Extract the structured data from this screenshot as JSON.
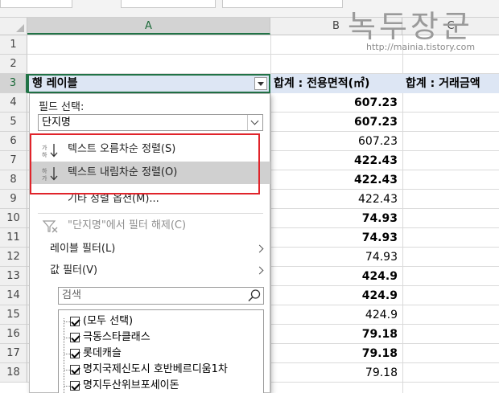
{
  "columns": [
    "A",
    "B",
    "C"
  ],
  "rows": [
    "1",
    "2",
    "3",
    "4",
    "5",
    "6",
    "7",
    "8",
    "9",
    "10",
    "11",
    "12",
    "13",
    "14",
    "15",
    "16",
    "17",
    "18"
  ],
  "header_row": {
    "row_label": "행 레이블",
    "area_sum": "합계 : 전용면적(㎡)",
    "price_sum": "합계 : 거래금액"
  },
  "b_values": [
    {
      "v": "607.23",
      "bold": true
    },
    {
      "v": "607.23",
      "bold": true
    },
    {
      "v": "607.23",
      "bold": false
    },
    {
      "v": "422.43",
      "bold": true
    },
    {
      "v": "422.43",
      "bold": true
    },
    {
      "v": "422.43",
      "bold": false
    },
    {
      "v": "74.93",
      "bold": true
    },
    {
      "v": "74.93",
      "bold": true
    },
    {
      "v": "74.93",
      "bold": false
    },
    {
      "v": "424.9",
      "bold": true
    },
    {
      "v": "424.9",
      "bold": true
    },
    {
      "v": "424.9",
      "bold": false
    },
    {
      "v": "79.18",
      "bold": true
    },
    {
      "v": "79.18",
      "bold": true
    },
    {
      "v": "79.18",
      "bold": false
    }
  ],
  "watermark": {
    "title": "녹두장군",
    "url": "http://mainia.tistory.com"
  },
  "panel": {
    "field_label": "필드 선택:",
    "field_value": "단지명",
    "sort_asc": "텍스트 오름차순 정렬(S)",
    "sort_desc": "텍스트 내림차순 정렬(O)",
    "more_sort": "기타 정렬 옵션(M)...",
    "clear_filter": "\"단지명\"에서 필터 해제(C)",
    "label_filter": "레이블 필터(L)",
    "value_filter": "값 필터(V)",
    "search_placeholder": "검색",
    "list": [
      "(모두 선택)",
      "극동스타클래스",
      "롯데캐슬",
      "명지국제신도시 호반베르디움1차",
      "명지두산위브포세이돈"
    ]
  },
  "colors": {
    "accent_green": "#217346",
    "highlight_red": "#e0242b",
    "pivot_header_blue": "#dde6f4"
  }
}
